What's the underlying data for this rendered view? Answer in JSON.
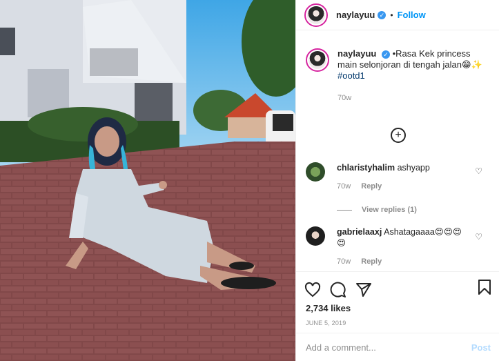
{
  "header": {
    "username": "naylayuu",
    "separator": "•",
    "follow_label": "Follow"
  },
  "caption": {
    "username": "naylayuu",
    "text": "•Rasa Kek princess main selonjoran di tengah jalan😁✨",
    "hashtag": "#ootd1",
    "time": "70w"
  },
  "load_more_icon": "plus-circle-icon",
  "comments": [
    {
      "username": "chlaristyhalim",
      "text": "ashyapp",
      "time": "70w",
      "reply": "Reply"
    },
    {
      "username": "gabrielaaxj",
      "text": "Ashatagaaaa😍😍😍😍",
      "time": "70w",
      "reply": "Reply"
    }
  ],
  "view_replies": "View replies (1)",
  "likes": "2,734 likes",
  "date": "JUNE 5, 2019",
  "add_comment": {
    "placeholder": "Add a comment...",
    "post_label": "Post"
  },
  "colors": {
    "accent": "#0095f6",
    "post_disabled": "#b3dbff",
    "muted": "#8e8e8e",
    "text": "#262626"
  }
}
